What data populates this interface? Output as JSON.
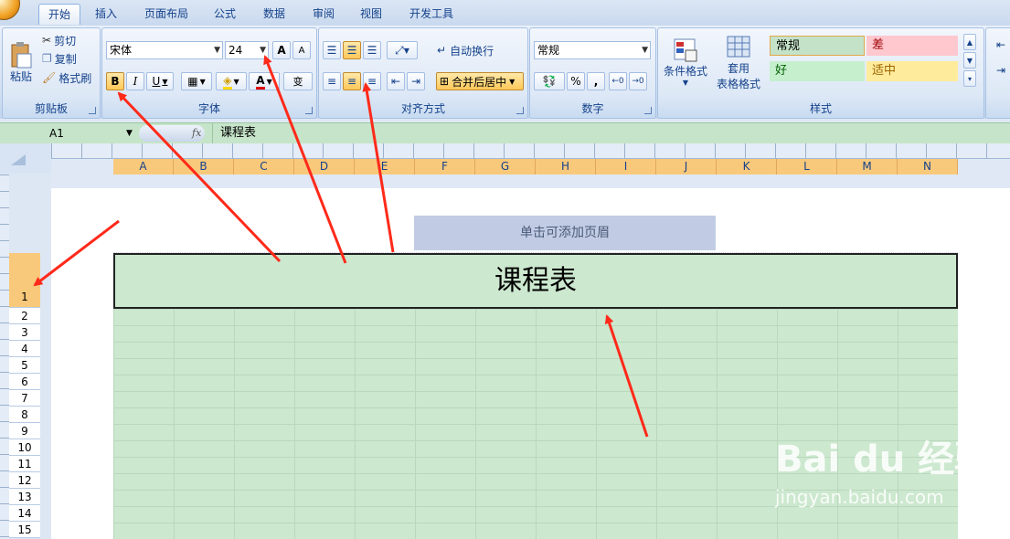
{
  "tabs": [
    "开始",
    "插入",
    "页面布局",
    "公式",
    "数据",
    "审阅",
    "视图",
    "开发工具"
  ],
  "clipboard": {
    "paste": "粘贴",
    "cut": "剪切",
    "copy": "复制",
    "format_painter": "格式刷",
    "label": "剪贴板"
  },
  "font": {
    "name": "宋体",
    "size": "24",
    "bold": "B",
    "italic": "I",
    "underline": "U",
    "label": "字体"
  },
  "alignment": {
    "wrap": "自动换行",
    "merge": "合并后居中",
    "label": "对齐方式"
  },
  "number": {
    "format": "常规",
    "percent": "%",
    "comma": ",",
    "label": "数字"
  },
  "styles": {
    "conditional": "条件格式",
    "table_format_1": "套用",
    "table_format_2": "表格格式",
    "normal": "常规",
    "bad": "差",
    "good": "好",
    "neutral": "适中",
    "label": "样式"
  },
  "formula_bar": {
    "name_box": "A1",
    "fx": "fx",
    "content": "课程表"
  },
  "columns": [
    "A",
    "B",
    "C",
    "D",
    "E",
    "F",
    "G",
    "H",
    "I",
    "J",
    "K",
    "L",
    "M",
    "N"
  ],
  "rows": [
    "1",
    "2",
    "3",
    "4",
    "5",
    "6",
    "7",
    "8",
    "9",
    "10",
    "11",
    "12",
    "13",
    "14",
    "15"
  ],
  "sheet": {
    "header_hint": "单击可添加页眉",
    "title": "课程表"
  },
  "watermark": {
    "brand": "Bai du 经验",
    "url": "jingyan.baidu.com"
  },
  "colors": {
    "accent_arrow": "#ff2a1a",
    "grid_fill": "#cce8cf",
    "col_header": "#f9c97b"
  }
}
